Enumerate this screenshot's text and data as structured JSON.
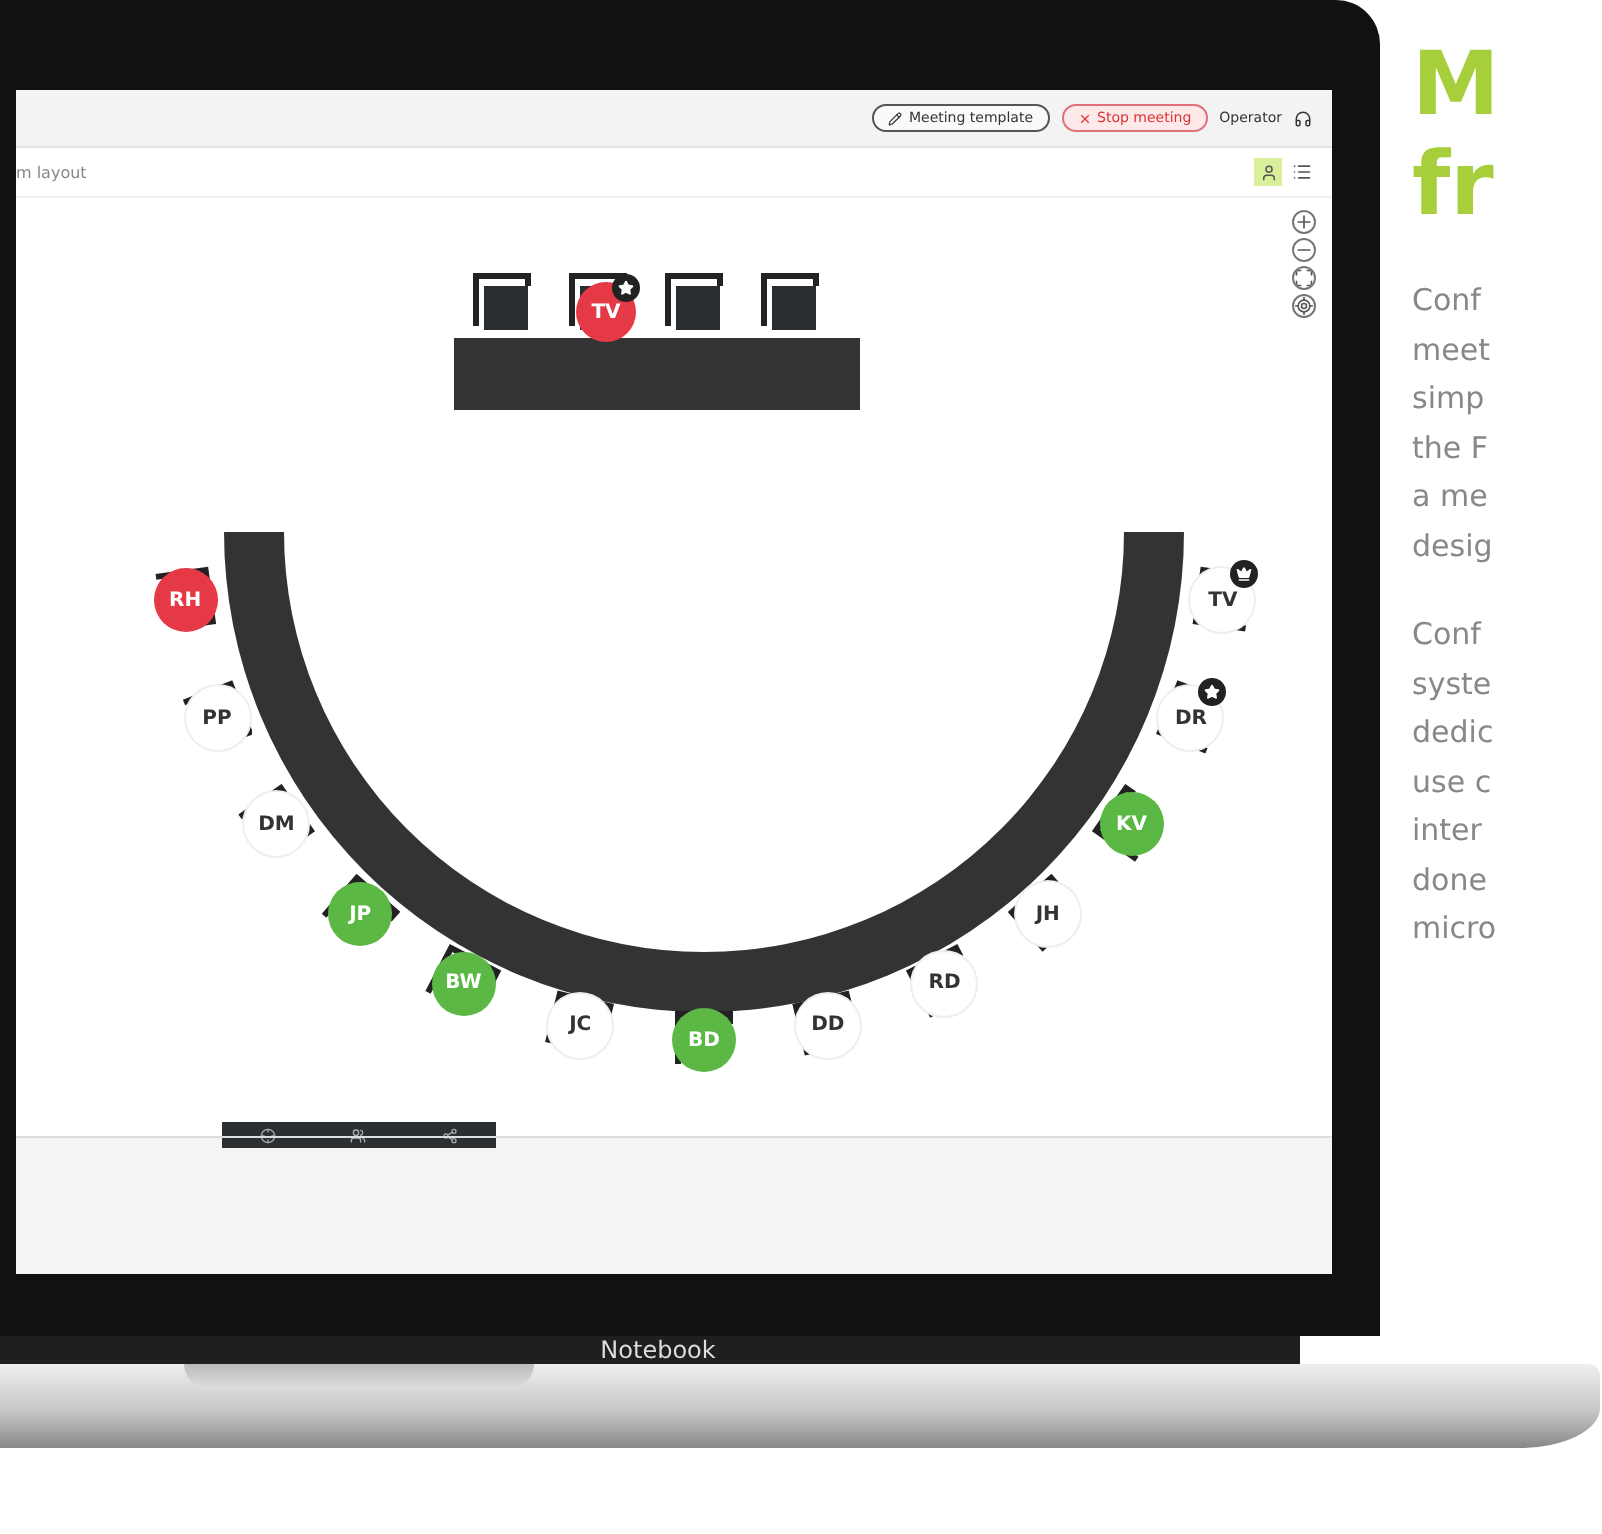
{
  "app": {
    "top_bar": {
      "buttons": [
        {
          "kind": "template",
          "label": "Meeting template"
        },
        {
          "kind": "stop",
          "label": "Stop meeting"
        }
      ],
      "operator": "Operator"
    },
    "sub_bar": {
      "title": "m layout",
      "view_toggle": [
        {
          "kind": "layout",
          "selected": true
        },
        {
          "kind": "list",
          "selected": false
        }
      ]
    },
    "head_table": {
      "seats": [
        {
          "kind": "empty"
        },
        {
          "kind": "occupied",
          "initials": "TV",
          "color": "#e63946",
          "starred": true
        },
        {
          "kind": "empty"
        },
        {
          "kind": "empty"
        }
      ]
    },
    "arc_seats": [
      {
        "initials": "RH",
        "color": "#e63946",
        "starred": false,
        "crowned": false
      },
      {
        "initials": "PP",
        "color": "#ffffff",
        "starred": false,
        "crowned": false
      },
      {
        "initials": "DM",
        "color": "#ffffff",
        "starred": false,
        "crowned": false
      },
      {
        "initials": "JP",
        "color": "#5bb845",
        "starred": false,
        "crowned": false
      },
      {
        "initials": "BW",
        "color": "#5bb845",
        "starred": false,
        "crowned": false
      },
      {
        "initials": "JC",
        "color": "#ffffff",
        "starred": false,
        "crowned": false
      },
      {
        "initials": "BD",
        "color": "#5bb845",
        "starred": false,
        "crowned": false
      },
      {
        "initials": "DD",
        "color": "#ffffff",
        "starred": false,
        "crowned": false
      },
      {
        "initials": "RD",
        "color": "#ffffff",
        "starred": false,
        "crowned": false
      },
      {
        "initials": "JH",
        "color": "#ffffff",
        "starred": false,
        "crowned": false
      },
      {
        "initials": "KV",
        "color": "#5bb845",
        "starred": false,
        "crowned": false
      },
      {
        "initials": "DR",
        "color": "#ffffff",
        "starred": true,
        "crowned": false
      },
      {
        "initials": "TV",
        "color": "#ffffff",
        "starred": false,
        "crowned": true
      }
    ]
  },
  "laptop_label": "Notebook",
  "article": {
    "heading": "M\nfr",
    "paragraphs": [
      "Conf\nmeet\nsimp\nthe F\na me\ndesig",
      "Conf\nsyste\ndedic\nuse c\ninter\ndone\nmicro"
    ]
  }
}
